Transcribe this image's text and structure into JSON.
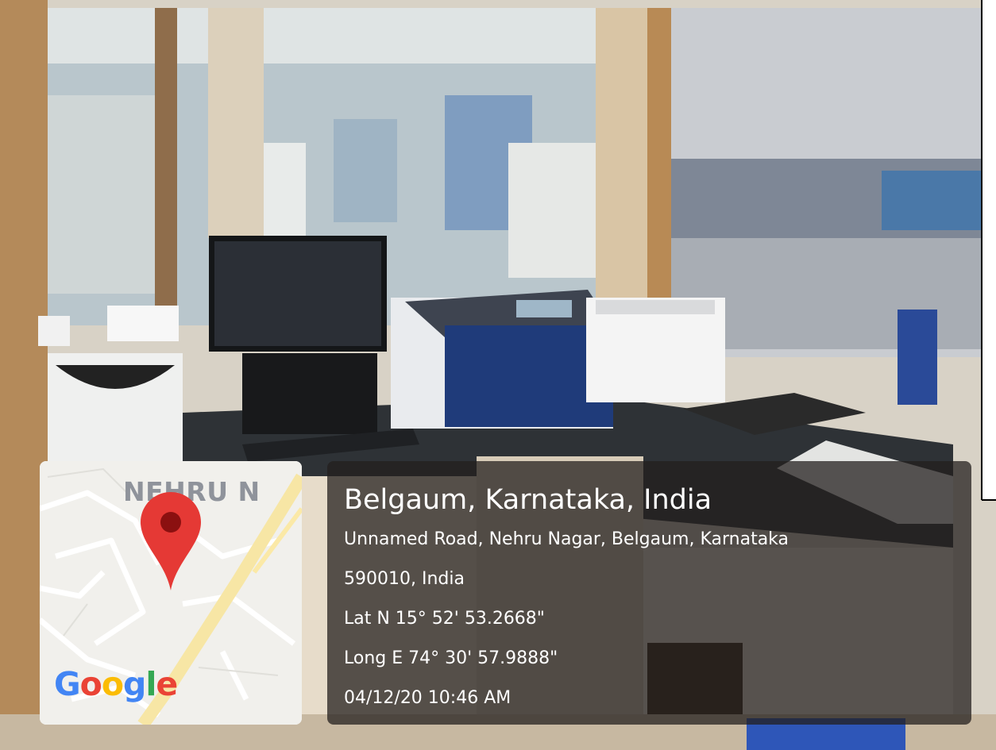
{
  "geotag": {
    "map_label": "NEHRU N",
    "google_logo": "Google",
    "google_colors": [
      "#4285F4",
      "#EA4335",
      "#FBBC05",
      "#4285F4",
      "#34A853",
      "#EA4335"
    ],
    "pin_icon": "map-pin-icon",
    "pin_color": "#E53935",
    "location_title": "Belgaum, Karnataka, India",
    "address_line1": "Unnamed Road, Nehru Nagar, Belgaum, Karnataka",
    "address_line2": "590010, India",
    "latitude": "Lat N 15° 52' 53.2668\"",
    "longitude": "Long E 74° 30' 57.9888\"",
    "timestamp": "04/12/20 10:46 AM"
  }
}
